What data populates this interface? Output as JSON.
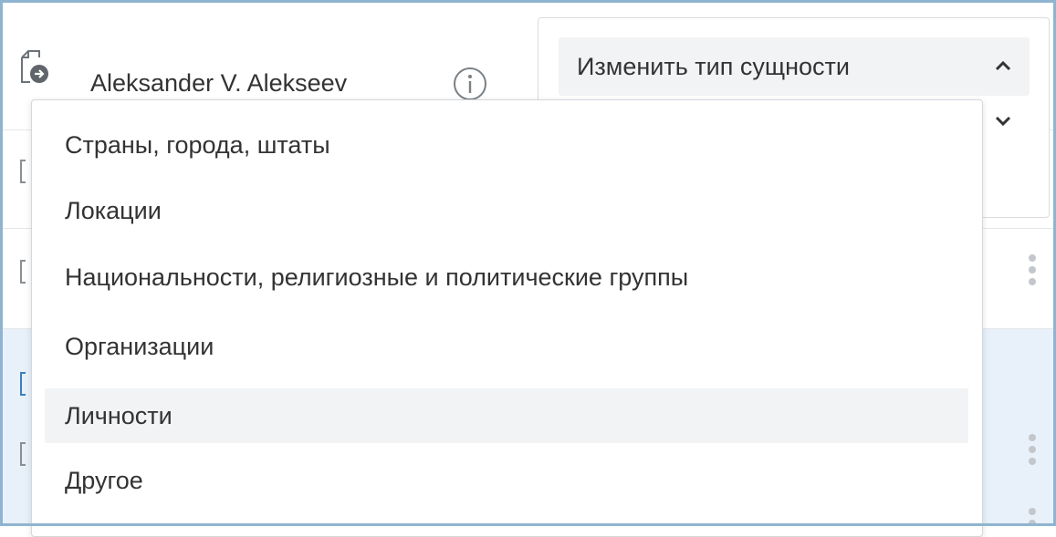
{
  "row1": {
    "author": "Aleksander V. Alekseev",
    "file_icon": "file-arrow-icon",
    "info_icon": "info-icon"
  },
  "entity_type": {
    "button_label": "Изменить тип сущности",
    "expanded": true,
    "options": [
      {
        "label": "Страны, города, штаты",
        "highlighted": false
      },
      {
        "label": "Локации",
        "highlighted": false
      },
      {
        "label": "Национальности, религиозные и политические группы",
        "highlighted": false
      },
      {
        "label": "Организации",
        "highlighted": false
      },
      {
        "label": "Личности",
        "highlighted": true
      },
      {
        "label": "Другое",
        "highlighted": false
      }
    ]
  },
  "colors": {
    "frame_border": "#8fb4cf",
    "selected_row_bg": "#e8f1fa",
    "hover_bg": "#f1f3f5",
    "text": "#333333"
  }
}
